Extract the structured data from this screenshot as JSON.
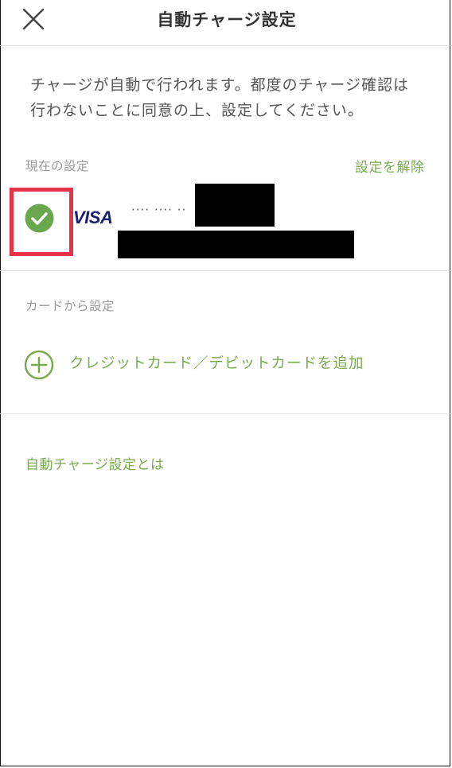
{
  "header": {
    "title": "自動チャージ設定",
    "close_icon": "close-icon"
  },
  "notice": {
    "line1": "チャージが自動で行われます。都度のチャージ確認は",
    "line2": "行わないことに同意の上、設定してください。"
  },
  "current_setting": {
    "label": "現在の設定",
    "release_label": "設定を解除",
    "card": {
      "brand": "VISA",
      "masked_number": "···· ···· ··",
      "selected": true
    }
  },
  "card_setting": {
    "label": "カードから設定",
    "add_label": "クレジットカード／デビットカードを追加"
  },
  "about_link": "自動チャージ設定とは",
  "colors": {
    "accent": "#7aaa4e",
    "highlight": "#e63348",
    "check": "#6aa84f",
    "visa": "#1a1f71"
  }
}
